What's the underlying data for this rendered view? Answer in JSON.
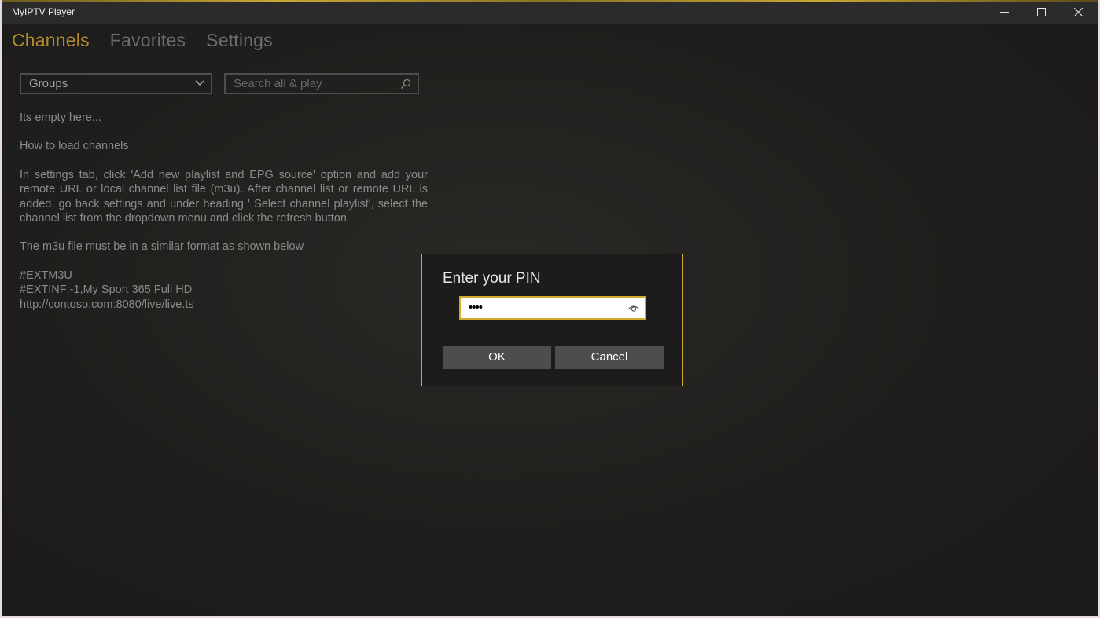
{
  "window": {
    "title": "MyIPTV Player"
  },
  "tabs": [
    {
      "label": "Channels",
      "active": true
    },
    {
      "label": "Favorites",
      "active": false
    },
    {
      "label": "Settings",
      "active": false
    }
  ],
  "groups_dropdown": {
    "selected": "Groups"
  },
  "search": {
    "placeholder": "Search all & play"
  },
  "content": {
    "empty": "Its empty here...",
    "howto_heading": "How to load channels",
    "instructions": "In settings tab, click 'Add new playlist and EPG source' option and add your remote URL or local channel list file (m3u). After channel list or remote URL is added, go back settings and under heading ' Select channel playlist', select the channel list from the dropdown menu and click the refresh button",
    "format_note": "The m3u file must be in a similar format as shown below",
    "sample_lines": [
      "#EXTM3U",
      "#EXTINF:-1,My Sport 365 Full HD",
      "http://contoso.com:8080/live/live.ts"
    ]
  },
  "dialog": {
    "title": "Enter your PIN",
    "pin_masked": "••••",
    "ok_label": "OK",
    "cancel_label": "Cancel"
  },
  "colors": {
    "accent": "#c9a634",
    "active_tab": "#b58a2a"
  },
  "icons": [
    "minimize-icon",
    "maximize-icon",
    "close-icon",
    "chevron-down-icon",
    "search-icon",
    "reveal-password-icon"
  ]
}
